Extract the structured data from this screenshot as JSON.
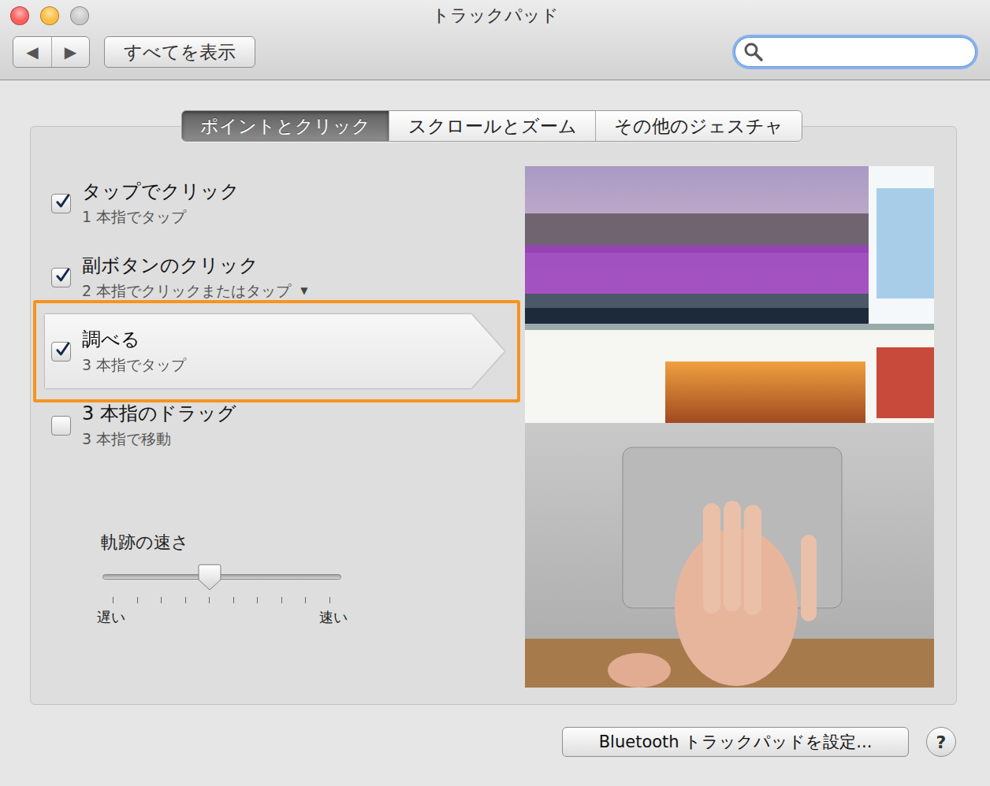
{
  "window": {
    "title": "トラックパッド",
    "controls": [
      {
        "name": "close",
        "color": "#fc605c"
      },
      {
        "name": "minimize",
        "color": "#fdbc40"
      },
      {
        "name": "zoom",
        "color": "#c9c9c9"
      }
    ]
  },
  "toolbar": {
    "back": "◀",
    "forward": "▶",
    "show_all": "すべてを表示",
    "search": {
      "placeholder": "",
      "focused": true
    }
  },
  "tabs": [
    {
      "label": "ポイントとクリック",
      "selected": true
    },
    {
      "label": "スクロールとズーム",
      "selected": false
    },
    {
      "label": "その他のジェスチャ",
      "selected": false
    }
  ],
  "options": [
    {
      "title": "タップでクリック",
      "subtitle": "1 本指でタップ",
      "checked": true,
      "selected": false,
      "highlighted": false
    },
    {
      "title": "副ボタンのクリック",
      "subtitle": "2 本指でクリックまたはタップ",
      "dropdown": "▼",
      "checked": true,
      "selected": false,
      "highlighted": false
    },
    {
      "title": "調べる",
      "subtitle": "3 本指でタップ",
      "checked": true,
      "selected": true,
      "highlighted": true
    },
    {
      "title": "3 本指のドラッグ",
      "subtitle": "3 本指で移動",
      "checked": false,
      "selected": false,
      "highlighted": false
    }
  ],
  "slider": {
    "label": "軌跡の速さ",
    "level": 0.45,
    "ticks": 10,
    "min_label": "遅い",
    "max_label": "速い"
  },
  "footer": {
    "bluetooth_button": "Bluetooth トラックパッドを設定...",
    "help": "?"
  }
}
